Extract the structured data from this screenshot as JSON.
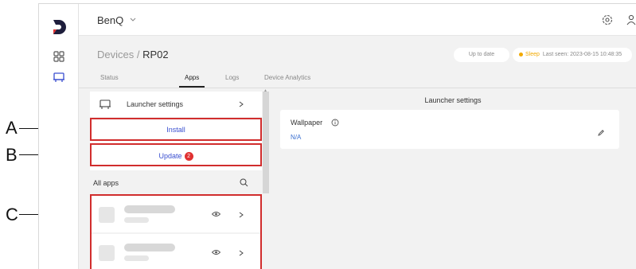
{
  "callouts": [
    "A",
    "B",
    "C"
  ],
  "org": {
    "name": "BenQ"
  },
  "breadcrumb": {
    "parent": "Devices",
    "separator": " / ",
    "current": "RP02"
  },
  "status": {
    "uptodate": "Up to date",
    "state": "Sleep",
    "last_seen": "Last seen: 2023-08-15 10:48:35",
    "state_color": "#f2a900"
  },
  "tabs": [
    {
      "label": "Status",
      "active": false
    },
    {
      "label": "Apps",
      "active": true
    },
    {
      "label": "Logs",
      "active": false
    },
    {
      "label": "Device Analytics",
      "active": false
    }
  ],
  "left": {
    "launcher_label": "Launcher settings",
    "install_label": "Install",
    "update_label": "Update",
    "update_count": "2",
    "all_apps_label": "All apps"
  },
  "right": {
    "title": "Launcher settings",
    "wallpaper_label": "Wallpaper",
    "wallpaper_value": "N/A"
  },
  "colors": {
    "accent": "#3a4fd0",
    "badge": "#e03131",
    "highlight_box": "#d12d2d"
  },
  "icons": [
    "logo-icon",
    "grid-icon",
    "launcher-icon",
    "chevron-down-icon",
    "gear-icon",
    "user-icon",
    "chevron-right-icon",
    "search-icon",
    "eye-icon",
    "info-icon",
    "edit-icon"
  ]
}
